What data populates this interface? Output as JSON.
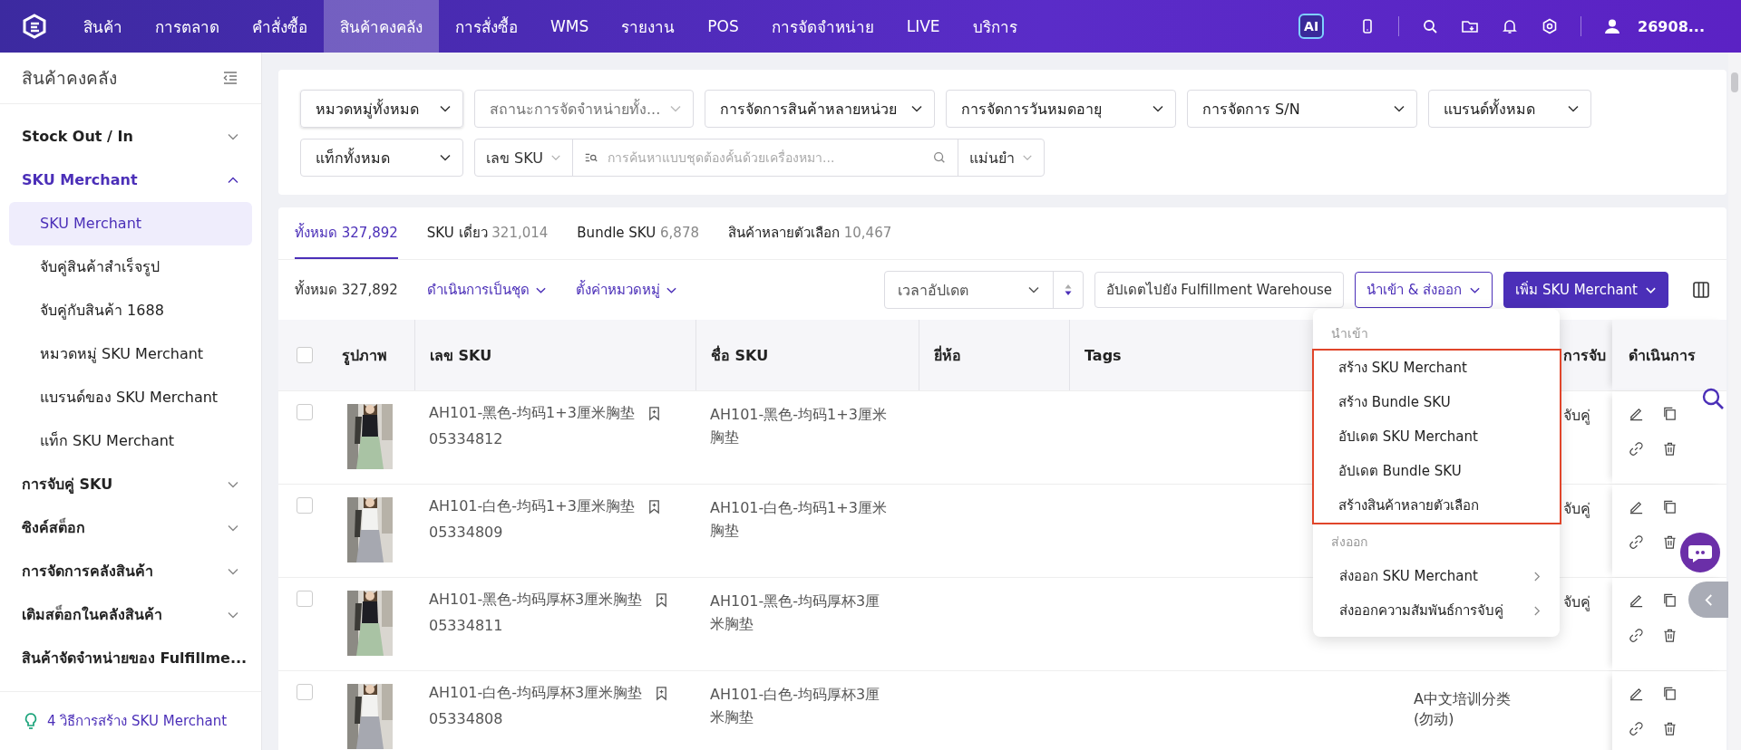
{
  "nav": {
    "items": [
      {
        "label": "สินค้า",
        "selected": false
      },
      {
        "label": "การตลาด",
        "selected": false
      },
      {
        "label": "คำสั่งซื้อ",
        "selected": false
      },
      {
        "label": "สินค้าคงคลัง",
        "selected": true
      },
      {
        "label": "การสั่งซื้อ",
        "selected": false
      },
      {
        "label": "WMS",
        "selected": false
      },
      {
        "label": "รายงาน",
        "selected": false
      },
      {
        "label": "POS",
        "selected": false
      },
      {
        "label": "การจัดจำหน่าย",
        "selected": false
      },
      {
        "label": "LIVE",
        "selected": false
      },
      {
        "label": "บริการ",
        "selected": false
      }
    ],
    "ai_badge": "AI",
    "user": "26908..."
  },
  "sidebar": {
    "title": "สินค้าคงคลัง",
    "groups": [
      {
        "label": "Stock Out / In",
        "expanded": false
      },
      {
        "label": "SKU Merchant",
        "expanded": true,
        "children": [
          {
            "label": "SKU Merchant",
            "selected": true
          },
          {
            "label": "จับคู่สินค้าสำเร็จรูป",
            "selected": false
          },
          {
            "label": "จับคู่กับสินค้า 1688",
            "selected": false
          },
          {
            "label": "หมวดหมู่ SKU Merchant",
            "selected": false
          },
          {
            "label": "แบรนด์ของ SKU Merchant",
            "selected": false
          },
          {
            "label": "แท็ก SKU Merchant",
            "selected": false
          }
        ]
      },
      {
        "label": "การจับคู่ SKU",
        "expanded": false
      },
      {
        "label": "ซิงค์สต็อก",
        "expanded": false
      },
      {
        "label": "การจัดการคลังสินค้า",
        "expanded": false
      },
      {
        "label": "เติมสต็อกในคลังสินค้า",
        "expanded": false
      },
      {
        "label": "สินค้าจัดจำหน่ายของ Fulfillme..."
      }
    ],
    "tip": "4 วิธีการสร้าง SKU Merchant"
  },
  "filters": {
    "row_1": [
      {
        "value": "หมวดหมู่ทั้งหมด",
        "disabled": false
      },
      {
        "value": "สถานะการจัดจำหน่ายทั้ง...",
        "disabled": true
      },
      {
        "value": "การจัดการสินค้าหลายหน่วย",
        "disabled": false
      },
      {
        "value": "การจัดการวันหมดอายุ",
        "disabled": false
      },
      {
        "value": "การจัดการ S/N",
        "disabled": false
      },
      {
        "value": "แบรนด์ทั้งหมด",
        "disabled": false
      }
    ],
    "tag_select": "แท็กทั้งหมด",
    "search_by": "เลข SKU",
    "search": {
      "placeholder": "การค้นหาแบบชุดต้องคั้นด้วยเครื่องหมา..."
    },
    "match_mode": "แม่นยำ"
  },
  "tabs": [
    {
      "label": "ทั้งหมด",
      "count": "327,892",
      "selected": true
    },
    {
      "label": "SKU เดี่ยว",
      "count": "321,014",
      "selected": false
    },
    {
      "label": "Bundle SKU",
      "count": "6,878",
      "selected": false
    },
    {
      "label": "สินค้าหลายตัวเลือก",
      "count": "10,467",
      "selected": false
    }
  ],
  "toolbar": {
    "total": "ทั้งหมด 327,892",
    "batch_action": "ดำเนินการเป็นชุด",
    "set_category": "ตั้งค่าหมวดหมู่",
    "sort": "เวลาอัปเดต",
    "sync_button": "อัปเดตไปยัง Fulfillment Warehouse",
    "import_export": {
      "label": "นำเข้า & ส่งออก",
      "expanded": true
    },
    "add_button": "เพิ่ม SKU Merchant"
  },
  "menu": {
    "sections": [
      {
        "title": "นำเข้า",
        "highlighted": true,
        "items": [
          {
            "label": "สร้าง SKU Merchant"
          },
          {
            "label": "สร้าง Bundle SKU"
          },
          {
            "label": "อัปเดต SKU Merchant"
          },
          {
            "label": "อัปเดต Bundle SKU"
          },
          {
            "label": "สร้างสินค้าหลายตัวเลือก"
          }
        ]
      },
      {
        "title": "ส่งออก",
        "items": [
          {
            "label": "ส่งออก SKU Merchant",
            "submenu": true
          },
          {
            "label": "ส่งออกความสัมพันธ์การจับคู่",
            "submenu": true
          }
        ]
      }
    ]
  },
  "table": {
    "select_all_checked": false,
    "columns": {
      "image": "รูปภาพ",
      "sku": "เลข SKU",
      "name": "ชื่อ SKU",
      "brand": "ยี่ห้อ",
      "tags": "Tags",
      "matching": "การจับ",
      "actions": "ดำเนินการ"
    },
    "rows": [
      {
        "sku": "AH101-黑色-均码1+3厘米胸垫",
        "code": "05334812",
        "name": "AH101-黑色-均码1+3厘米胸垫",
        "matching": "จับคู่",
        "checked": false
      },
      {
        "sku": "AH101-白色-均码1+3厘米胸垫",
        "code": "05334809",
        "name": "AH101-白色-均码1+3厘米胸垫",
        "matching": "จับคู่",
        "checked": false
      },
      {
        "sku": "AH101-黑色-均码厚杯3厘米胸垫",
        "code": "05334811",
        "name": "AH101-黑色-均码厚杯3厘米胸垫",
        "matching": "จับคู่",
        "checked": false
      },
      {
        "sku": "AH101-白色-均码厚杯3厘米胸垫",
        "code": "05334808",
        "name": "AH101-白色-均码厚杯3厘米胸垫",
        "column_7": "A中文培训分类 (勿动)",
        "checked": false
      }
    ]
  }
}
